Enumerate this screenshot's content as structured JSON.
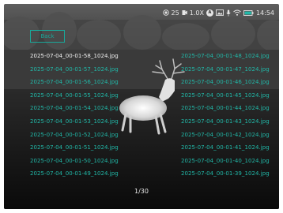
{
  "status_bar": {
    "temperature": "25",
    "zoom": "1.0X",
    "time": "14:54",
    "icons": [
      "recording-status-icon",
      "camera-icon",
      "auto-badge-icon",
      "image-mode-icon",
      "microphone-icon",
      "wifi-icon",
      "battery-icon"
    ],
    "auto_badge": "A"
  },
  "back_button": {
    "label": "Back"
  },
  "files_left": [
    "2025-07-04_00-01-58_1024.jpg",
    "2025-07-04_00-01-57_1024.jpg",
    "2025-07-04_00-01-56_1024.jpg",
    "2025-07-04_00-01-55_1024.jpg",
    "2025-07-04_00-01-54_1024.jpg",
    "2025-07-04_00-01-53_1024.jpg",
    "2025-07-04_00-01-52_1024.jpg",
    "2025-07-04_00-01-51_1024.jpg",
    "2025-07-04_00-01-50_1024.jpg",
    "2025-07-04_00-01-49_1024.jpg"
  ],
  "files_right": [
    "2025-07-04_00-01-48_1024.jpg",
    "2025-07-04_00-01-47_1024.jpg",
    "2025-07-04_00-01-46_1024.jpg",
    "2025-07-04_00-01-45_1024.jpg",
    "2025-07-04_00-01-44_1024.jpg",
    "2025-07-04_00-01-43_1024.jpg",
    "2025-07-04_00-01-42_1024.jpg",
    "2025-07-04_00-01-41_1024.jpg",
    "2025-07-04_00-01-40_1024.jpg",
    "2025-07-04_00-01-39_1024.jpg"
  ],
  "selected_file": "2025-07-04_00-01-58_1024.jpg",
  "page_indicator": "1/30",
  "colors": {
    "accent": "#21b8a8",
    "selected_text": "#f0f0f0",
    "frame_border": "#19a89a"
  }
}
